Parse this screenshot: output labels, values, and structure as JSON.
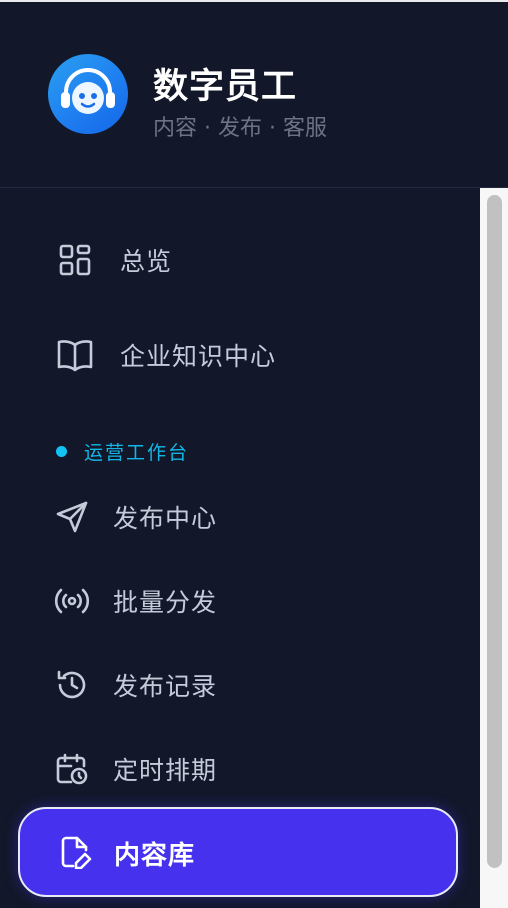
{
  "brand": {
    "title": "数字员工",
    "subtitle": "内容 · 发布 · 客服",
    "avatar_icon": "headset-robot-icon"
  },
  "nav": {
    "items": [
      {
        "label": "总览",
        "icon": "grid-icon"
      },
      {
        "label": "企业知识中心",
        "icon": "book-icon"
      }
    ],
    "section_label": "运营工作台",
    "section_items": [
      {
        "label": "发布中心",
        "icon": "send-icon"
      },
      {
        "label": "批量分发",
        "icon": "broadcast-icon"
      },
      {
        "label": "发布记录",
        "icon": "history-icon"
      },
      {
        "label": "定时排期",
        "icon": "calendar-clock-icon"
      }
    ],
    "active_item": {
      "label": "内容库",
      "icon": "file-edit-icon"
    }
  },
  "colors": {
    "background": "#121829",
    "accent": "#4631ef",
    "section_accent": "#12b7e8",
    "text": "#c4cbd9"
  }
}
